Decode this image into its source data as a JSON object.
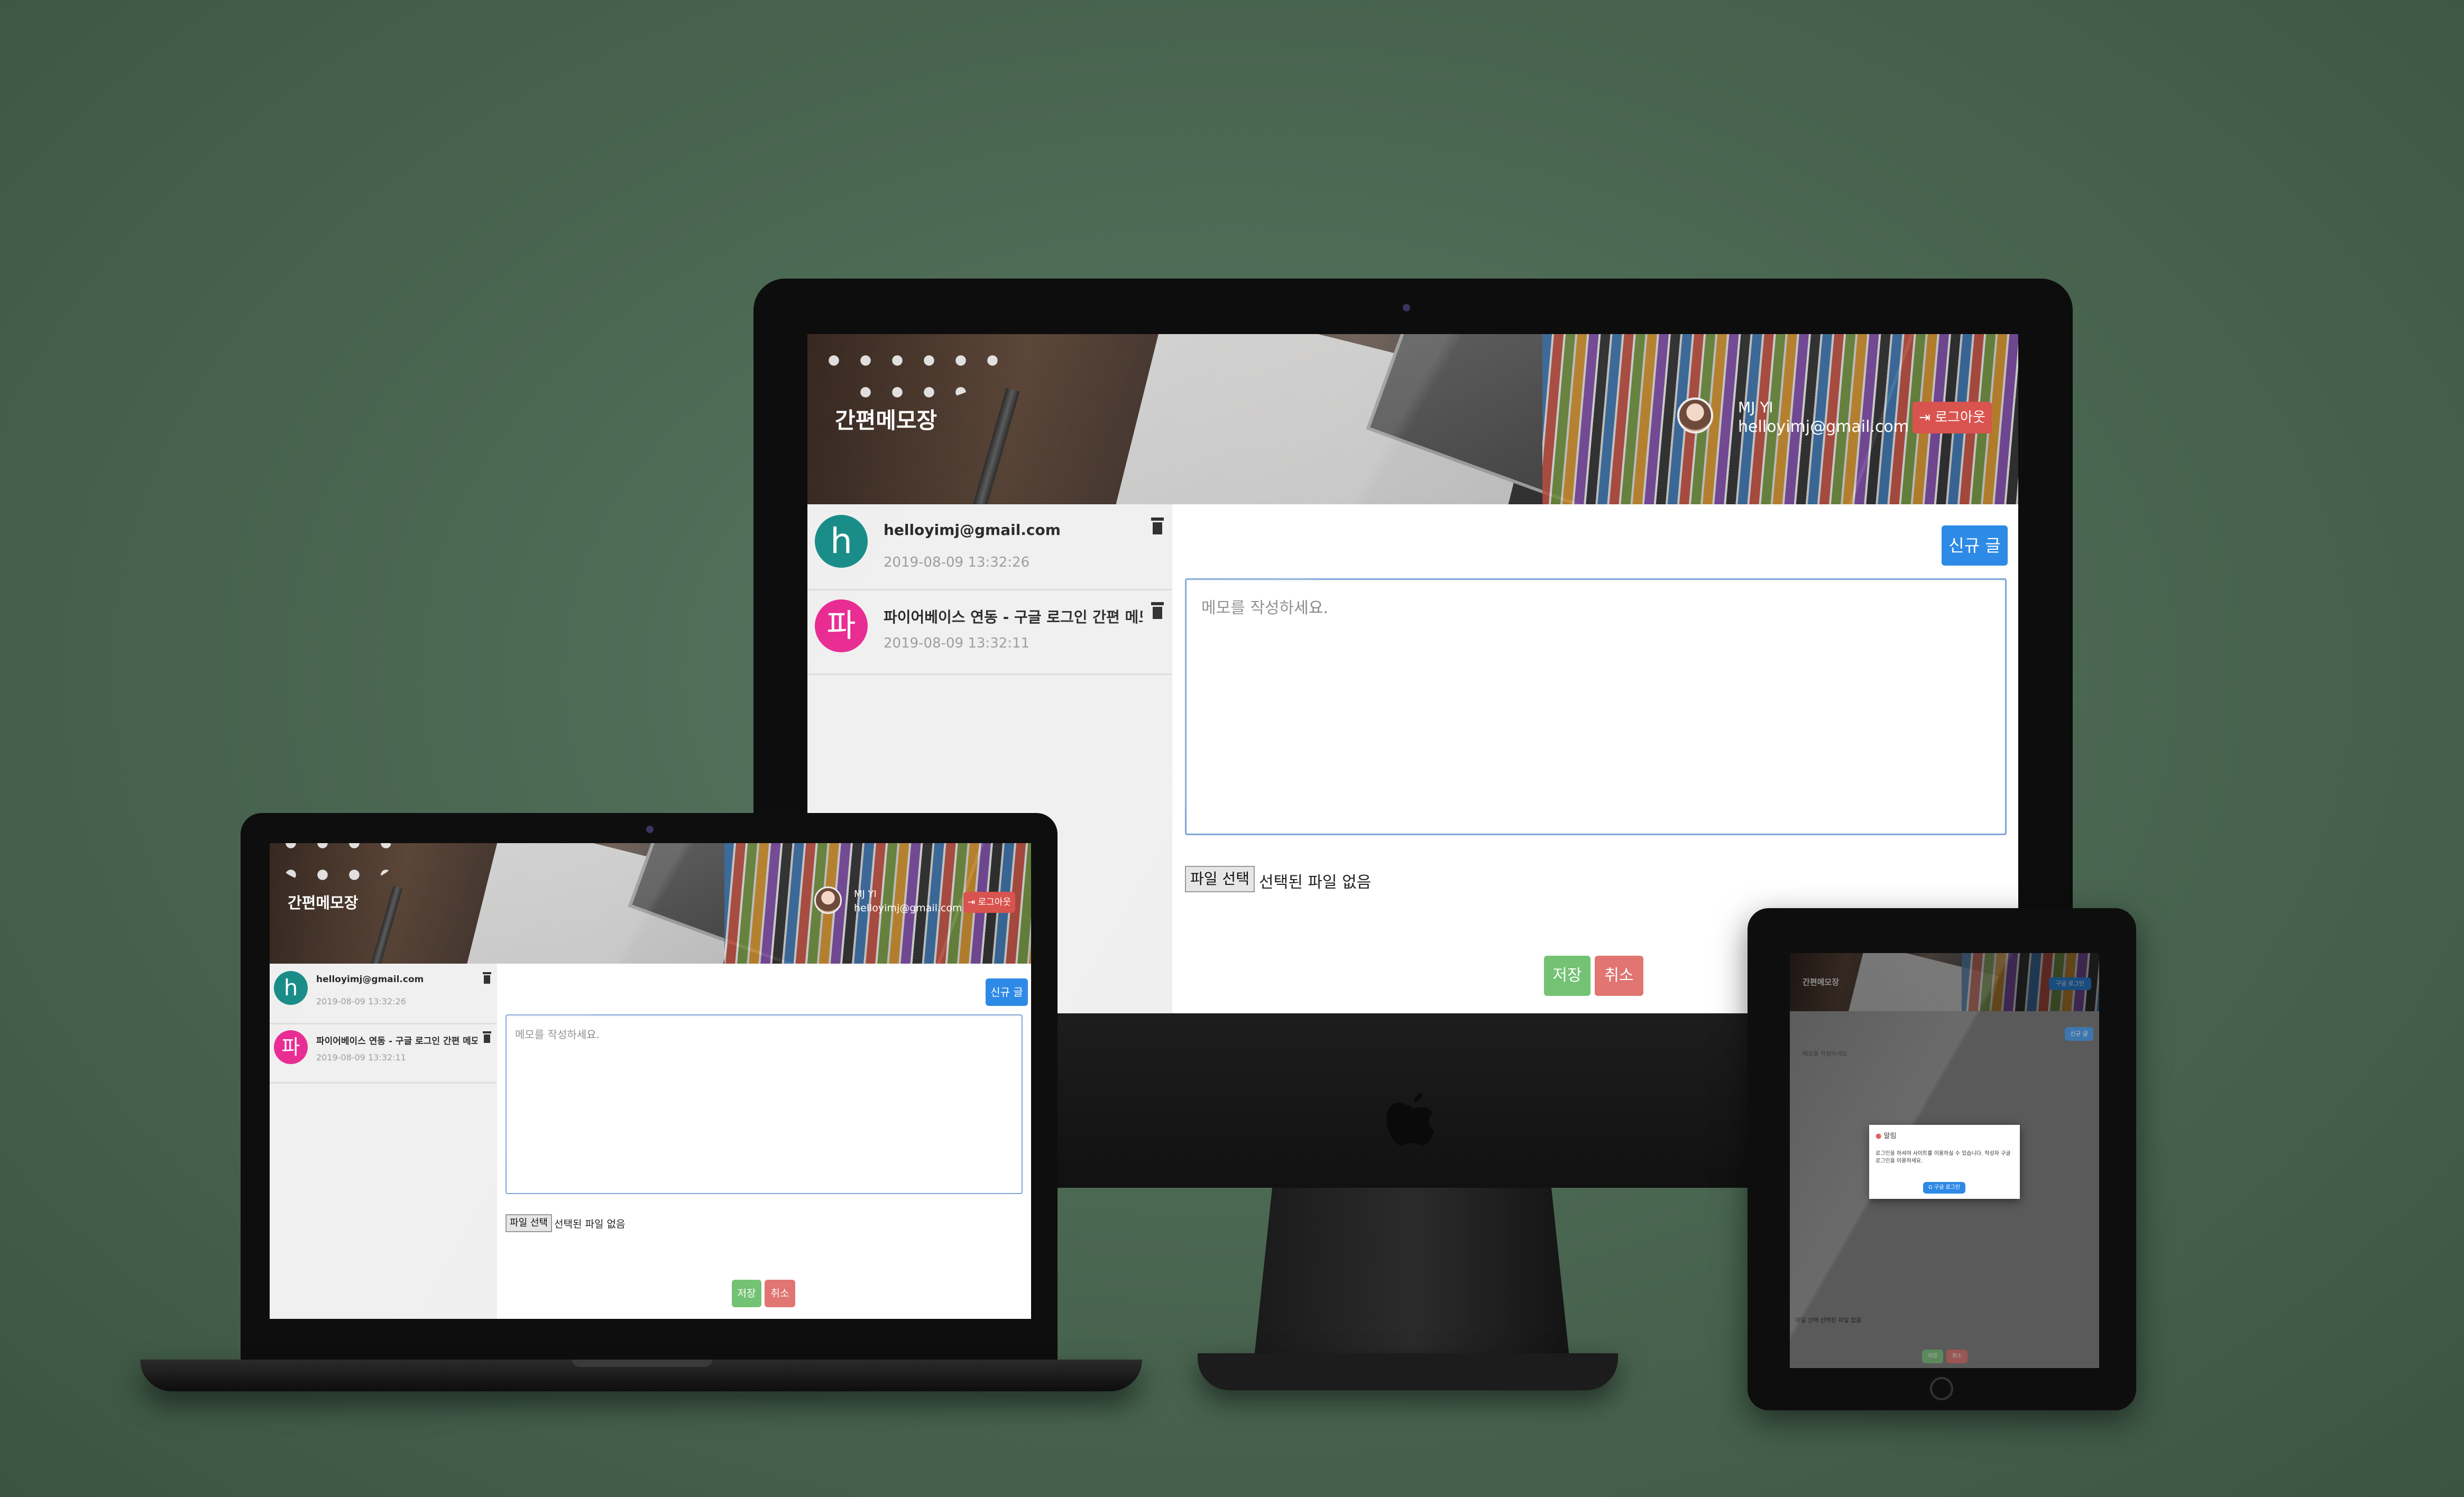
{
  "app": {
    "title": "간편메모장",
    "user_name": "MJ YI",
    "user_email": "helloyimj@gmail.com",
    "logout_label": "로그아웃",
    "new_label": "신규 글",
    "placeholder": "메모를 작성하세요.",
    "file_button": "파일 선택",
    "file_status": "선택된 파일 없음",
    "save_label": "저장",
    "cancel_label": "취소"
  },
  "memos": [
    {
      "avatar_letter": "h",
      "avatar_color": "#148a86",
      "title": "helloyimj@gmail.com",
      "date": "2019-08-09 13:32:26"
    },
    {
      "avatar_letter": "파",
      "avatar_color": "#e8268f",
      "title": "파이어베이스 연동 - 구글 로그인 간편 메모",
      "date": "2019-08-09 13:32:11"
    }
  ],
  "tablet": {
    "file_row": "파일 선택 선택된 파일 없음",
    "alert_title": "알림",
    "alert_message": "로그인을 하셔야 사이트를 이용하실 수 있습니다. 작성자 구글 로그인을 이용하세요.",
    "alert_button": "구글 로그인"
  },
  "colors": {
    "background": "#4b6853",
    "primary": "#2d8ae6",
    "success": "#5cb85c",
    "danger": "#d9534f",
    "textarea_border": "#7fa7d9"
  }
}
